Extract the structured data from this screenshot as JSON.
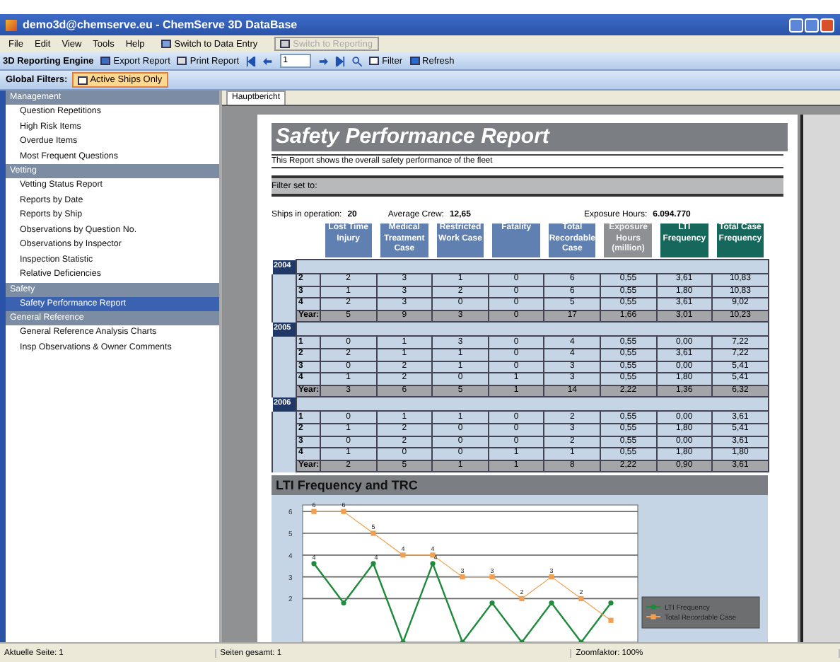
{
  "window": {
    "title": "demo3d@chemserve.eu - ChemServe 3D DataBase"
  },
  "menu": {
    "items": [
      "File",
      "Edit",
      "View",
      "Tools",
      "Help"
    ],
    "switch_buttons": [
      {
        "label": "Switch to Data Entry",
        "disabled": false
      },
      {
        "label": "Switch to Reporting",
        "disabled": true
      }
    ]
  },
  "toolbar": {
    "title": "3D Reporting Engine",
    "export": "Export Report",
    "print": "Print Report",
    "page": "1",
    "filter": "Filter",
    "refresh": "Refresh"
  },
  "global_filters": {
    "label": "Global Filters:",
    "button": {
      "label": "Active Ships Only",
      "active": true
    }
  },
  "sidebar": {
    "groups": [
      {
        "header": "Management",
        "items": [
          {
            "label": "Question Repetitions",
            "selected": false
          },
          {
            "label": "High Risk Items",
            "selected": false
          },
          {
            "label": "Overdue Items",
            "selected": false
          },
          {
            "label": "Most Frequent Questions",
            "selected": false
          }
        ]
      },
      {
        "header": "Vetting",
        "items": [
          {
            "label": "Vetting Status Report",
            "selected": false
          },
          {
            "label": "Reports by Date",
            "selected": false
          },
          {
            "label": "Reports by Ship",
            "selected": false
          },
          {
            "label": "Observations by Question No.",
            "selected": false
          },
          {
            "label": "Observations by Inspector",
            "selected": false
          },
          {
            "label": "Inspection Statistic",
            "selected": false
          },
          {
            "label": "Relative Deficiencies",
            "selected": false
          }
        ]
      },
      {
        "header": "Safety",
        "items": [
          {
            "label": "Safety Performance Report",
            "selected": true
          }
        ]
      },
      {
        "header": "General Reference",
        "items": [
          {
            "label": "General Reference Analysis Charts",
            "selected": false
          },
          {
            "label": "Insp Observations & Owner Comments",
            "selected": false
          }
        ]
      }
    ]
  },
  "tabs": [
    {
      "label": "Hauptbericht",
      "selected": true
    }
  ],
  "report": {
    "title": "Safety Performance Report",
    "description": "This Report shows the overall safety performance of the fleet",
    "filter_label": "Filter set to:",
    "stats": [
      {
        "label": "Ships in operation:",
        "value": "20"
      },
      {
        "label": "Average Crew:",
        "value": "12,65"
      },
      {
        "label": "Exposure Hours:",
        "value": "6.094.770"
      }
    ],
    "columns": [
      {
        "label": "Lost Time Injury",
        "kind": "blue"
      },
      {
        "label": "Medical Treatment Case",
        "kind": "blue"
      },
      {
        "label": "Restricted Work Case",
        "kind": "blue"
      },
      {
        "label": "Fatality",
        "kind": "blue"
      },
      {
        "label": "Total Recordable Case",
        "kind": "blue"
      },
      {
        "label": "Exposure Hours (million)",
        "kind": "grey"
      },
      {
        "label": "LTI Frequency",
        "kind": "teal"
      },
      {
        "label": "Total Case Frequency",
        "kind": "teal"
      }
    ],
    "years": [
      {
        "year": "2004",
        "rows": [
          {
            "quarter": "2",
            "cells": [
              "2",
              "3",
              "1",
              "0",
              "6",
              "0,55",
              "3,61",
              "10,83"
            ]
          },
          {
            "quarter": "3",
            "cells": [
              "1",
              "3",
              "2",
              "0",
              "6",
              "0,55",
              "1,80",
              "10,83"
            ]
          },
          {
            "quarter": "4",
            "cells": [
              "2",
              "3",
              "0",
              "0",
              "5",
              "0,55",
              "3,61",
              "9,02"
            ]
          }
        ],
        "total": {
          "label": "Year:",
          "cells": [
            "5",
            "9",
            "3",
            "0",
            "17",
            "1,66",
            "3,01",
            "10,23"
          ]
        }
      },
      {
        "year": "2005",
        "rows": [
          {
            "quarter": "1",
            "cells": [
              "0",
              "1",
              "3",
              "0",
              "4",
              "0,55",
              "0,00",
              "7,22"
            ]
          },
          {
            "quarter": "2",
            "cells": [
              "2",
              "1",
              "1",
              "0",
              "4",
              "0,55",
              "3,61",
              "7,22"
            ]
          },
          {
            "quarter": "3",
            "cells": [
              "0",
              "2",
              "1",
              "0",
              "3",
              "0,55",
              "0,00",
              "5,41"
            ]
          },
          {
            "quarter": "4",
            "cells": [
              "1",
              "2",
              "0",
              "1",
              "3",
              "0,55",
              "1,80",
              "5,41"
            ]
          }
        ],
        "total": {
          "label": "Year:",
          "cells": [
            "3",
            "6",
            "5",
            "1",
            "14",
            "2,22",
            "1,36",
            "6,32"
          ]
        }
      },
      {
        "year": "2006",
        "rows": [
          {
            "quarter": "1",
            "cells": [
              "0",
              "1",
              "1",
              "0",
              "2",
              "0,55",
              "0,00",
              "3,61"
            ]
          },
          {
            "quarter": "2",
            "cells": [
              "1",
              "2",
              "0",
              "0",
              "3",
              "0,55",
              "1,80",
              "5,41"
            ]
          },
          {
            "quarter": "3",
            "cells": [
              "0",
              "2",
              "0",
              "0",
              "2",
              "0,55",
              "0,00",
              "3,61"
            ]
          },
          {
            "quarter": "4",
            "cells": [
              "1",
              "0",
              "0",
              "1",
              "1",
              "0,55",
              "1,80",
              "1,80"
            ]
          }
        ],
        "total": {
          "label": "Year:",
          "cells": [
            "2",
            "5",
            "1",
            "1",
            "8",
            "2,22",
            "0,90",
            "3,61"
          ]
        }
      }
    ],
    "chart": {
      "heading": "LTI Frequency and TRC",
      "chart_data": {
        "type": "line",
        "ylim": [
          0,
          6.3
        ],
        "yticks": [
          2,
          3,
          4,
          5,
          6
        ],
        "grid": true,
        "legend": true,
        "series": [
          {
            "name": "LTI Frequency",
            "color": "#1e8a3c",
            "marker": "circle",
            "values": [
              3.61,
              1.8,
              3.61,
              0,
              3.61,
              0,
              1.8,
              0,
              1.8,
              0,
              1.8
            ],
            "value_labels": [
              "4",
              null,
              "4",
              null,
              "4",
              null,
              null,
              null,
              null,
              null,
              null
            ]
          },
          {
            "name": "Total Recordable Case",
            "color": "#f0a050",
            "marker": "square",
            "values": [
              6,
              6,
              5,
              4,
              4,
              3,
              3,
              2,
              3,
              2,
              1
            ],
            "value_labels": [
              "6",
              "6",
              "5",
              "4",
              "4",
              "3",
              "3",
              "2",
              "3",
              "2",
              null
            ]
          }
        ]
      }
    }
  },
  "status_bar": [
    "Aktuelle Seite: 1",
    "Seiten gesamt: 1",
    "Zoomfaktor: 100%"
  ]
}
